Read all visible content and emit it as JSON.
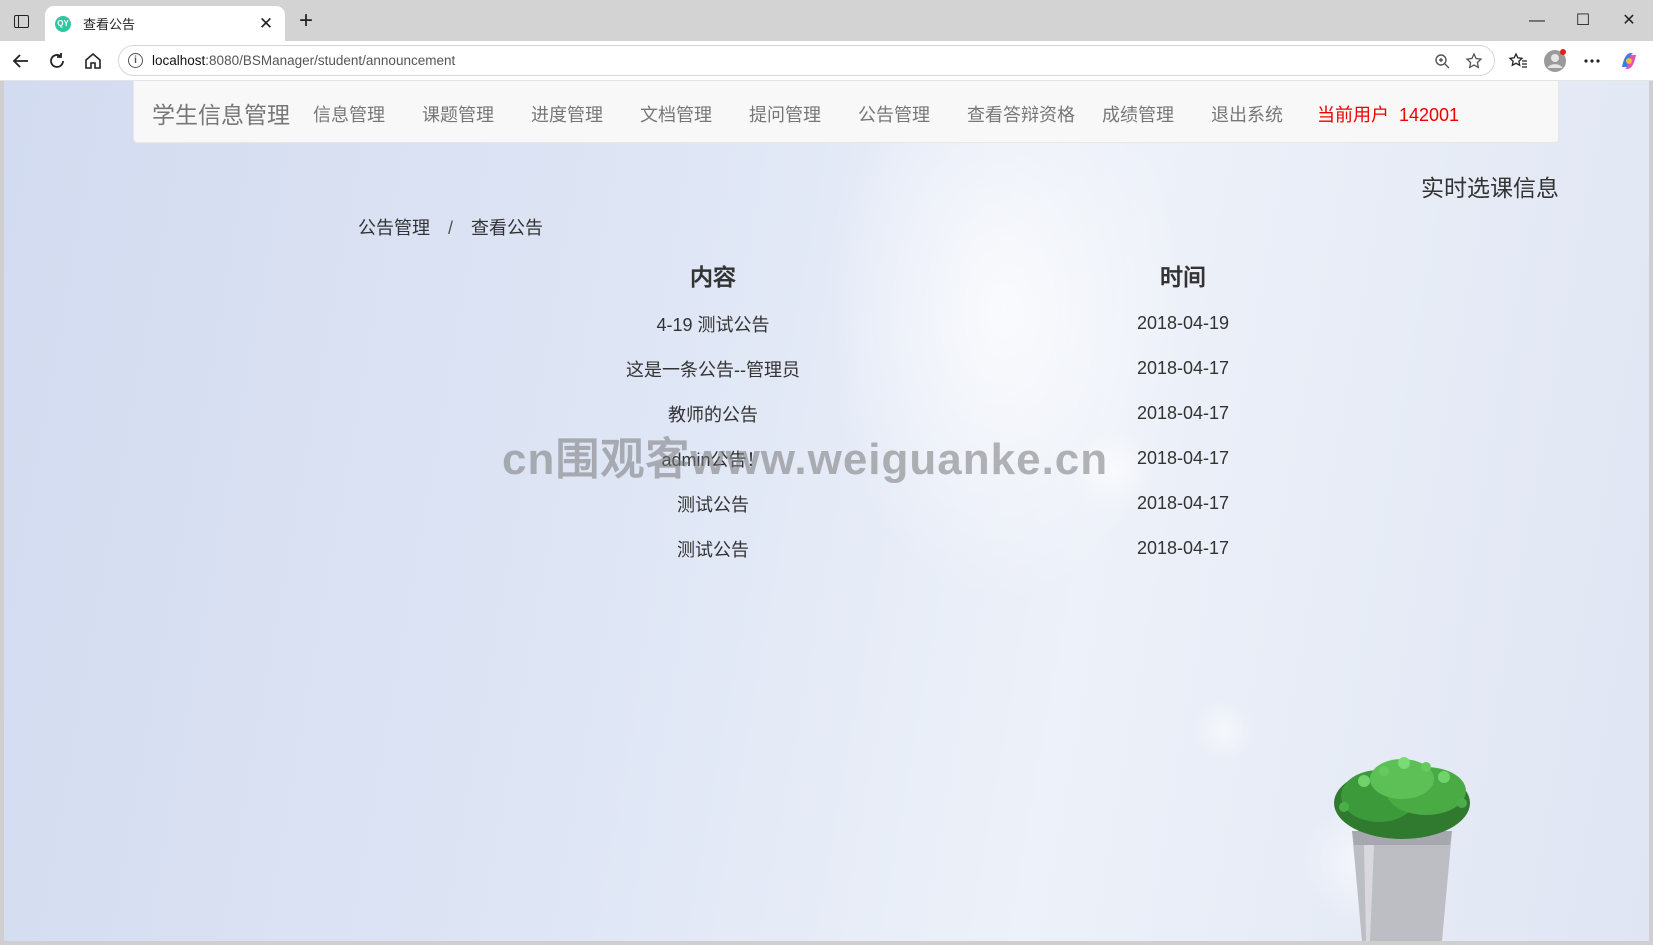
{
  "browser": {
    "tab_title": "查看公告",
    "favicon_text": "QY",
    "url_host": "localhost",
    "url_path": ":8080/BSManager/student/announcement"
  },
  "nav": {
    "brand": "学生信息管理",
    "items": [
      "信息管理",
      "课题管理",
      "进度管理",
      "文档管理",
      "提问管理",
      "公告管理",
      "查看答辩资格",
      "成绩管理",
      "退出系统"
    ],
    "current_user_label": "当前用户",
    "current_user_id": "142001"
  },
  "side_title": "实时选课信息",
  "breadcrumb": {
    "parent": "公告管理",
    "separator": "/",
    "current": "查看公告"
  },
  "table": {
    "headers": [
      "内容",
      "时间"
    ],
    "rows": [
      [
        "4-19 测试公告",
        "2018-04-19"
      ],
      [
        "这是一条公告--管理员",
        "2018-04-17"
      ],
      [
        "教师的公告",
        "2018-04-17"
      ],
      [
        "admin公告！",
        "2018-04-17"
      ],
      [
        "测试公告",
        "2018-04-17"
      ],
      [
        "测试公告",
        "2018-04-17"
      ]
    ]
  },
  "watermark": "cn围观客www.weiguanke.cn",
  "colors": {
    "user_red": "#ee0000",
    "nav_text": "#777777"
  }
}
